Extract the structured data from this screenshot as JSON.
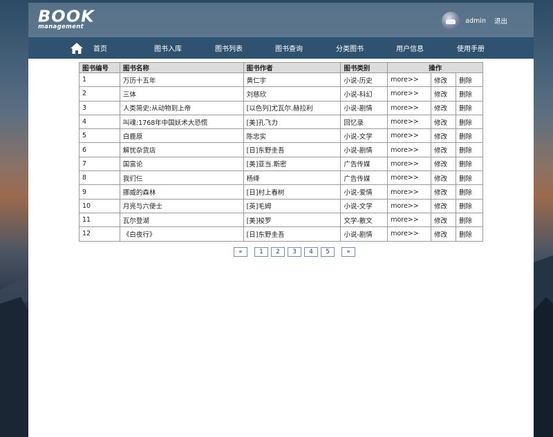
{
  "header": {
    "logo_main": "BOOK",
    "logo_sub": "management",
    "user_name": "admin",
    "logout_label": "退出"
  },
  "nav": {
    "items": [
      {
        "label": "首页",
        "icon": "home-icon"
      },
      {
        "label": "图书入库"
      },
      {
        "label": "图书列表"
      },
      {
        "label": "图书查询"
      },
      {
        "label": "分类图书"
      },
      {
        "label": "用户信息"
      },
      {
        "label": "使用手册"
      }
    ]
  },
  "table": {
    "headers": [
      "图书编号",
      "图书名称",
      "图书作者",
      "图书类别",
      "操作"
    ],
    "action_labels": {
      "more": "more>>",
      "edit": "修改",
      "delete": "删除"
    },
    "rows": [
      [
        "1",
        "万历十五年",
        "黄仁宇",
        "小说-历史"
      ],
      [
        "2",
        "三体",
        "刘慈欣",
        "小说-科幻"
      ],
      [
        "3",
        "人类简史:从动物到上帝",
        "[以色列]尤瓦尔.赫拉利",
        "小说-剧情"
      ],
      [
        "4",
        "叫魂:1768年中国妖术大恐慌",
        "[美]孔飞力",
        "回忆录"
      ],
      [
        "5",
        "白鹿原",
        "陈忠实",
        "小说-文学"
      ],
      [
        "6",
        "解忧杂货店",
        "[日]东野圭吾",
        "小说-剧情"
      ],
      [
        "7",
        "国富论",
        "[美]亚当.斯密",
        "广告传媒"
      ],
      [
        "8",
        "我们仨",
        "杨绛",
        "广告传媒"
      ],
      [
        "9",
        "挪威的森林",
        "[日]村上春树",
        "小说-爱情"
      ],
      [
        "10",
        "月亮与六便士",
        "[英]毛姆",
        "小说-文学"
      ],
      [
        "11",
        "瓦尔登湖",
        "[美]梭罗",
        "文学-散文"
      ],
      [
        "12",
        "《白夜行》",
        "[日]东野圭吾",
        "小说-剧情"
      ]
    ]
  },
  "pager": {
    "prev": "«",
    "pages": [
      "1",
      "2",
      "3",
      "4",
      "5"
    ],
    "next": "»"
  },
  "colors": {
    "nav_bg": "#2f5271",
    "header_bg": "#7891a5",
    "table_header_bg": "#dcdcdc",
    "pager_text": "#1f3b8a"
  }
}
